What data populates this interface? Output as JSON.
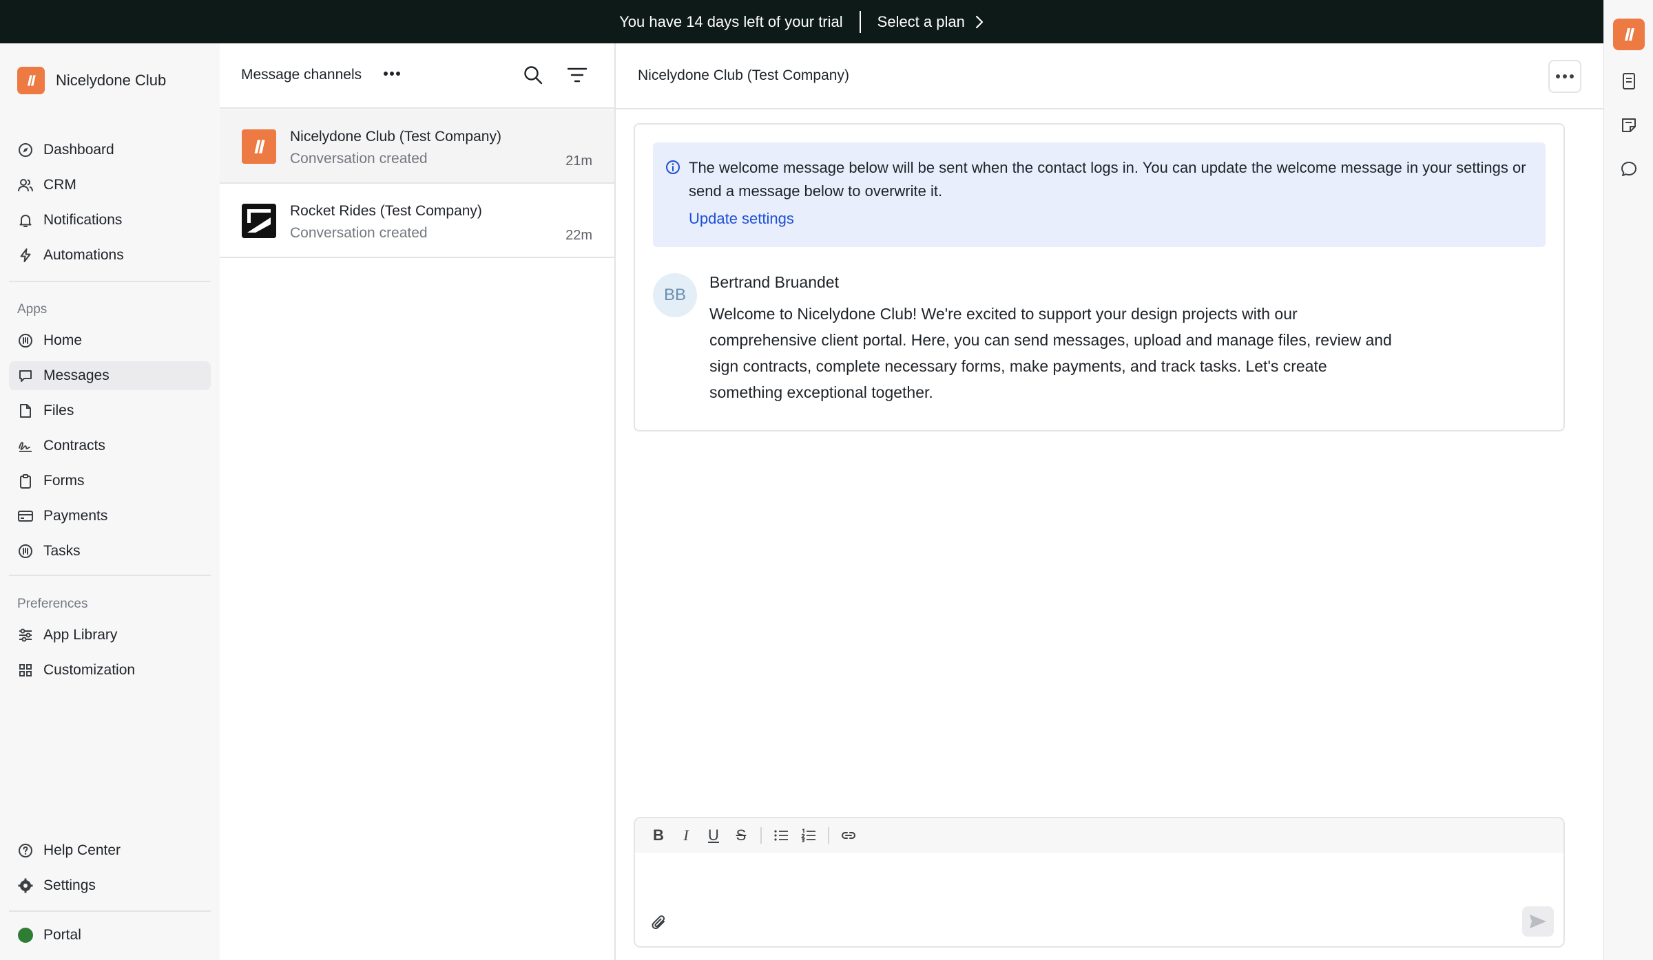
{
  "banner": {
    "trial_text": "You have 14 days left of your trial",
    "plan_label": "Select a plan"
  },
  "sidebar": {
    "brand_name": "Nicelydone Club",
    "main_items": [
      {
        "label": "Dashboard",
        "icon": "compass-icon"
      },
      {
        "label": "CRM",
        "icon": "users-icon"
      },
      {
        "label": "Notifications",
        "icon": "bell-icon"
      },
      {
        "label": "Automations",
        "icon": "bolt-icon"
      }
    ],
    "apps_label": "Apps",
    "apps_items": [
      {
        "label": "Home",
        "icon": "home-app-icon"
      },
      {
        "label": "Messages",
        "icon": "message-icon",
        "active": true
      },
      {
        "label": "Files",
        "icon": "file-icon"
      },
      {
        "label": "Contracts",
        "icon": "signature-icon"
      },
      {
        "label": "Forms",
        "icon": "clipboard-icon"
      },
      {
        "label": "Payments",
        "icon": "credit-card-icon"
      },
      {
        "label": "Tasks",
        "icon": "tasks-icon"
      }
    ],
    "preferences_label": "Preferences",
    "preferences_items": [
      {
        "label": "App Library",
        "icon": "sliders-icon"
      },
      {
        "label": "Customization",
        "icon": "grid-icon"
      }
    ],
    "footer_items": [
      {
        "label": "Help Center",
        "icon": "help-circle-icon"
      },
      {
        "label": "Settings",
        "icon": "gear-icon"
      }
    ],
    "portal_label": "Portal",
    "portal_color": "#2e7d32"
  },
  "channels": {
    "title": "Message channels",
    "items": [
      {
        "name": "Nicelydone Club (Test Company)",
        "subtitle": "Conversation created",
        "time": "21m",
        "selected": true
      },
      {
        "name": "Rocket Rides (Test Company)",
        "subtitle": "Conversation created",
        "time": "22m",
        "selected": false
      }
    ]
  },
  "conversation": {
    "title": "Nicelydone Club (Test Company)",
    "info_text": "The welcome message below will be sent when the contact logs in. You can update the welcome message in your settings or send a message below to overwrite it.",
    "info_link": "Update settings",
    "message": {
      "initials": "BB",
      "author": "Bertrand Bruandet",
      "body": "Welcome to Nicelydone Club! We're excited to support your design projects with our comprehensive client portal. Here, you can send messages, upload and manage files, review and sign contracts, complete necessary forms, make payments, and track tasks. Let's create something exceptional together."
    }
  },
  "composer": {
    "bold": "B",
    "italic": "I",
    "underline": "U",
    "strike": "S",
    "placeholder": ""
  },
  "colors": {
    "brand": "#ed7a43",
    "banner_bg": "#0e1a17",
    "link": "#1d4ed8",
    "info_bg": "#e8eefc"
  }
}
